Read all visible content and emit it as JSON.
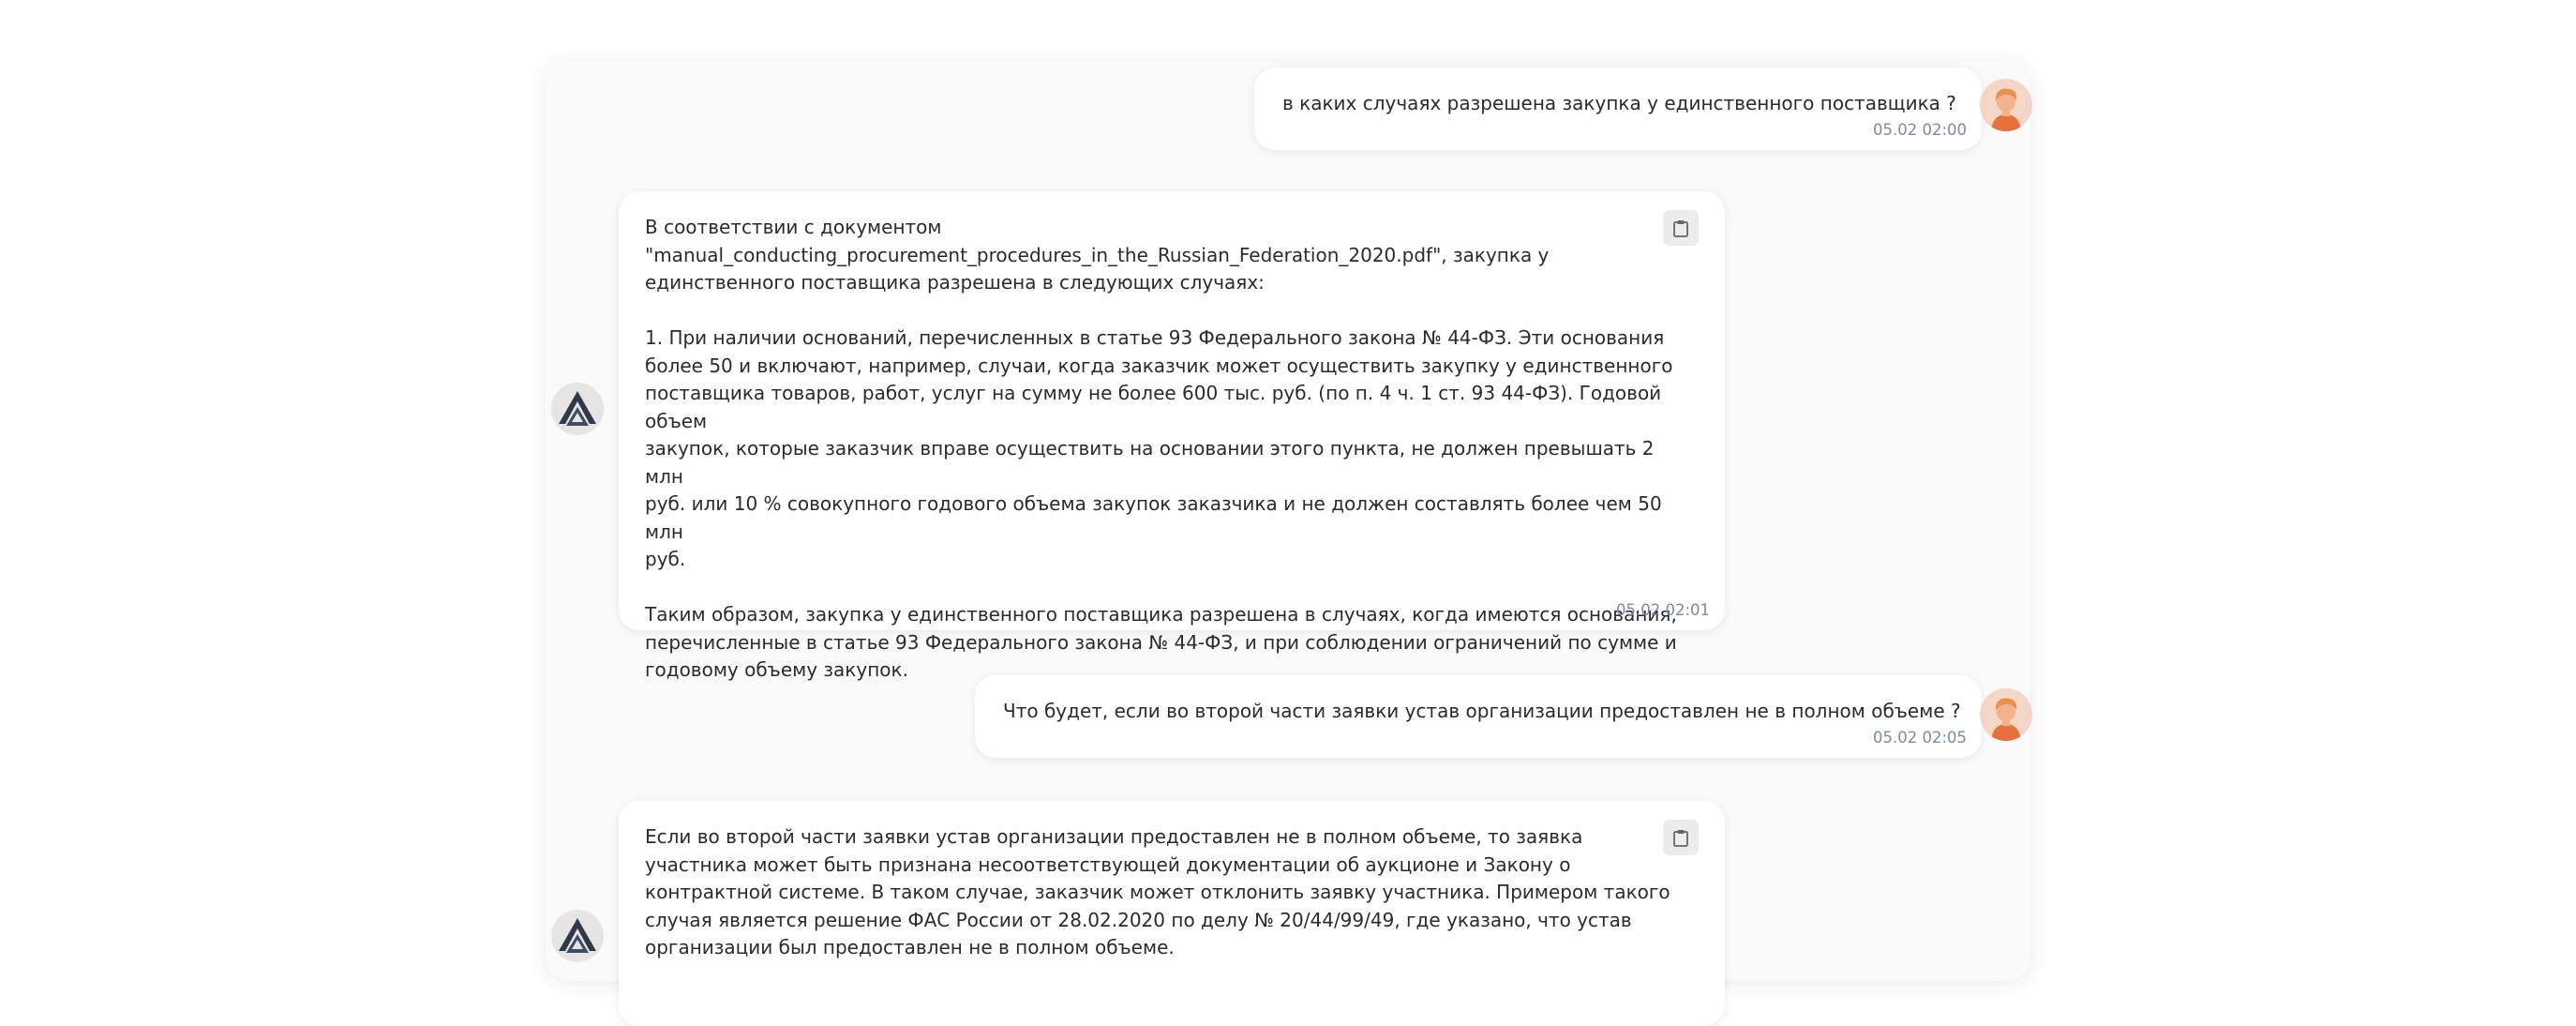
{
  "messages": [
    {
      "role": "user",
      "text": "в каких случаях разрешена закупка у единственного поставщика ?",
      "time": "05.02 02:00"
    },
    {
      "role": "assistant",
      "text": "В соответствии с документом\n\"manual_conducting_procurement_procedures_in_the_Russian_Federation_2020.pdf\", закупка у\nединственного поставщика разрешена в следующих случаях:\n\n1. При наличии оснований, перечисленных в статье 93 Федерального закона № 44-ФЗ. Эти основания\nболее 50 и включают, например, случаи, когда заказчик может осуществить закупку у единственного\nпоставщика товаров, работ, услуг на сумму не более 600 тыс. руб. (по п. 4 ч. 1 ст. 93 44-ФЗ). Годовой объем\nзакупок, которые заказчик вправе осуществить на основании этого пункта, не должен превышать 2 млн\nруб. или 10 % совокупного годового объема закупок заказчика и не должен составлять более чем 50 млн\nруб.\n\nТаким образом, закупка у единственного поставщика разрешена в случаях, когда имеются основания,\nперечисленные в статье 93 Федерального закона № 44-ФЗ, и при соблюдении ограничений по сумме и\nгодовому объему закупок.",
      "time": "05.02 02:01"
    },
    {
      "role": "user",
      "text": "Что будет, если во второй части заявки устав организации предоставлен не в полном объеме ?",
      "time": "05.02 02:05"
    },
    {
      "role": "assistant",
      "text": "Если во второй части заявки устав организации предоставлен не в полном объеме, то заявка\nучастника может быть признана несоответствующей документации об аукционе и Закону о\nконтрактной системе. В таком случае, заказчик может отклонить заявку участника. Примером такого\nслучая является решение ФАС России от 28.02.2020 по делу № 20/44/99/49, где указано, что устав\nорганизации был предоставлен не в полном объеме.",
      "time": ""
    }
  ],
  "icons": {
    "copy": "clipboard-icon",
    "user_avatar": "user-avatar-icon",
    "bot_avatar": "bot-logo-icon"
  },
  "colors": {
    "panel_bg": "#fafafa",
    "bubble_bg": "#ffffff",
    "timestamp": "#7f8aa6",
    "avatar_skin": "#f1b28c",
    "avatar_hair": "#e89050",
    "avatar_shirt": "#e8703c",
    "bot_logo_dark": "#2e3a4c"
  }
}
